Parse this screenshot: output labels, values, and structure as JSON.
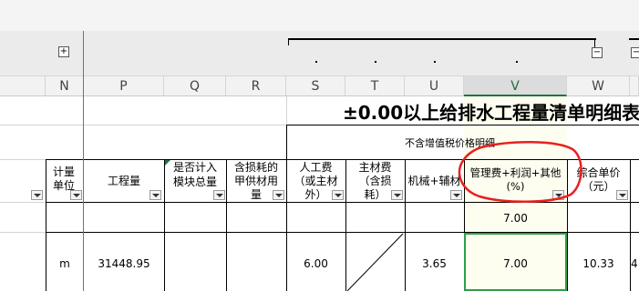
{
  "sheet": {
    "columns": [
      "N",
      "P",
      "Q",
      "R",
      "S",
      "T",
      "U",
      "V",
      "W"
    ],
    "selected_column": "V",
    "outline_plus": "+",
    "outline_minus": "−",
    "title": "±0.00以上给排水工程量清单明细表",
    "subheader": "不含增值税价格明细",
    "headers": {
      "N": "计量\n单位",
      "P": "工程量",
      "Q": "是否计入\n模块总量",
      "R": "含损耗的\n甲供材用\n量",
      "S": "人工费\n（或主材\n外）",
      "T": "主材费\n（含损\n耗）",
      "U": "机械+辅材",
      "V": "管理费+利润+其他\n(%)",
      "W": "综合单价\n（元）"
    },
    "rate_row": {
      "V": "7.00"
    },
    "data_row": {
      "N": "m",
      "P": "31448.95",
      "S": "6.00",
      "U": "3.65",
      "V": "7.00",
      "W": "10.33",
      "edge": "4"
    }
  },
  "colors": {
    "freeze_line": "#2f9e3f",
    "selection": "#2e9e47",
    "annotation": "#e8201e",
    "highlight_column": "#fdfeef"
  }
}
